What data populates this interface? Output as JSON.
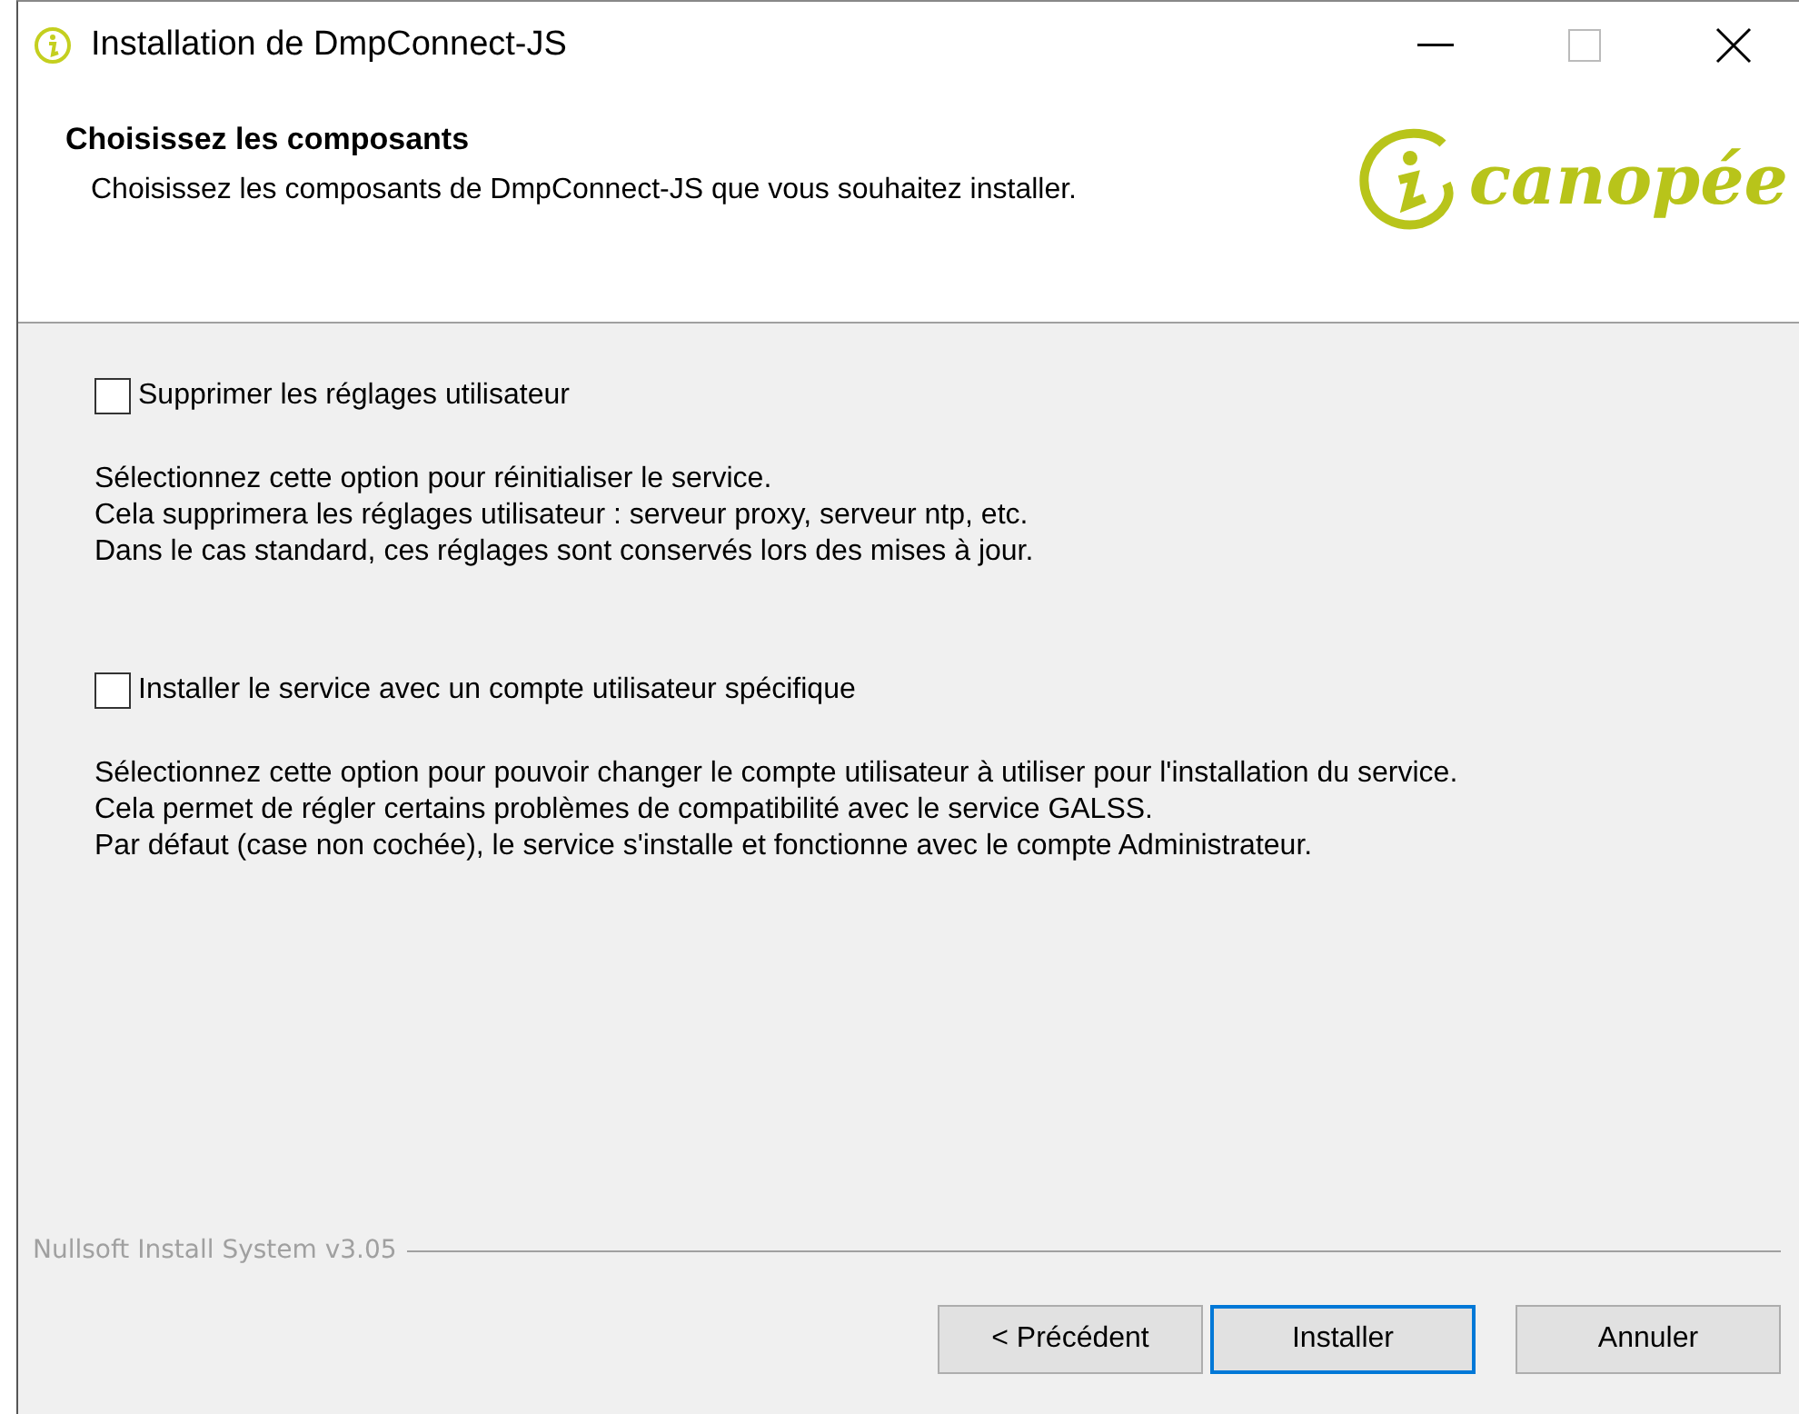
{
  "window": {
    "title": "Installation de DmpConnect-JS"
  },
  "header": {
    "title": "Choisissez les composants",
    "subtitle": "Choisissez les composants de DmpConnect-JS que vous souhaitez installer.",
    "logo_text": "canopée"
  },
  "options": [
    {
      "label": "Supprimer les réglages utilisateur",
      "checked": false,
      "description": [
        "Sélectionnez cette option pour réinitialiser le service.",
        "Cela supprimera les réglages utilisateur : serveur proxy, serveur ntp, etc.",
        "Dans le cas standard, ces réglages sont conservés lors des mises à jour."
      ]
    },
    {
      "label": "Installer le service avec un compte utilisateur spécifique",
      "checked": false,
      "description": [
        "Sélectionnez cette option pour pouvoir changer le compte utilisateur à utiliser pour l'installation du service.",
        "Cela permet de régler certains problèmes de compatibilité avec le service GALSS.",
        "Par défaut (case non cochée), le service s'installe et fonctionne avec le compte Administrateur."
      ]
    }
  ],
  "branding": "Nullsoft Install System v3.05",
  "buttons": [
    {
      "label": "< Précédent",
      "default": false
    },
    {
      "label": "Installer",
      "default": true
    },
    {
      "label": "Annuler",
      "default": false
    }
  ]
}
